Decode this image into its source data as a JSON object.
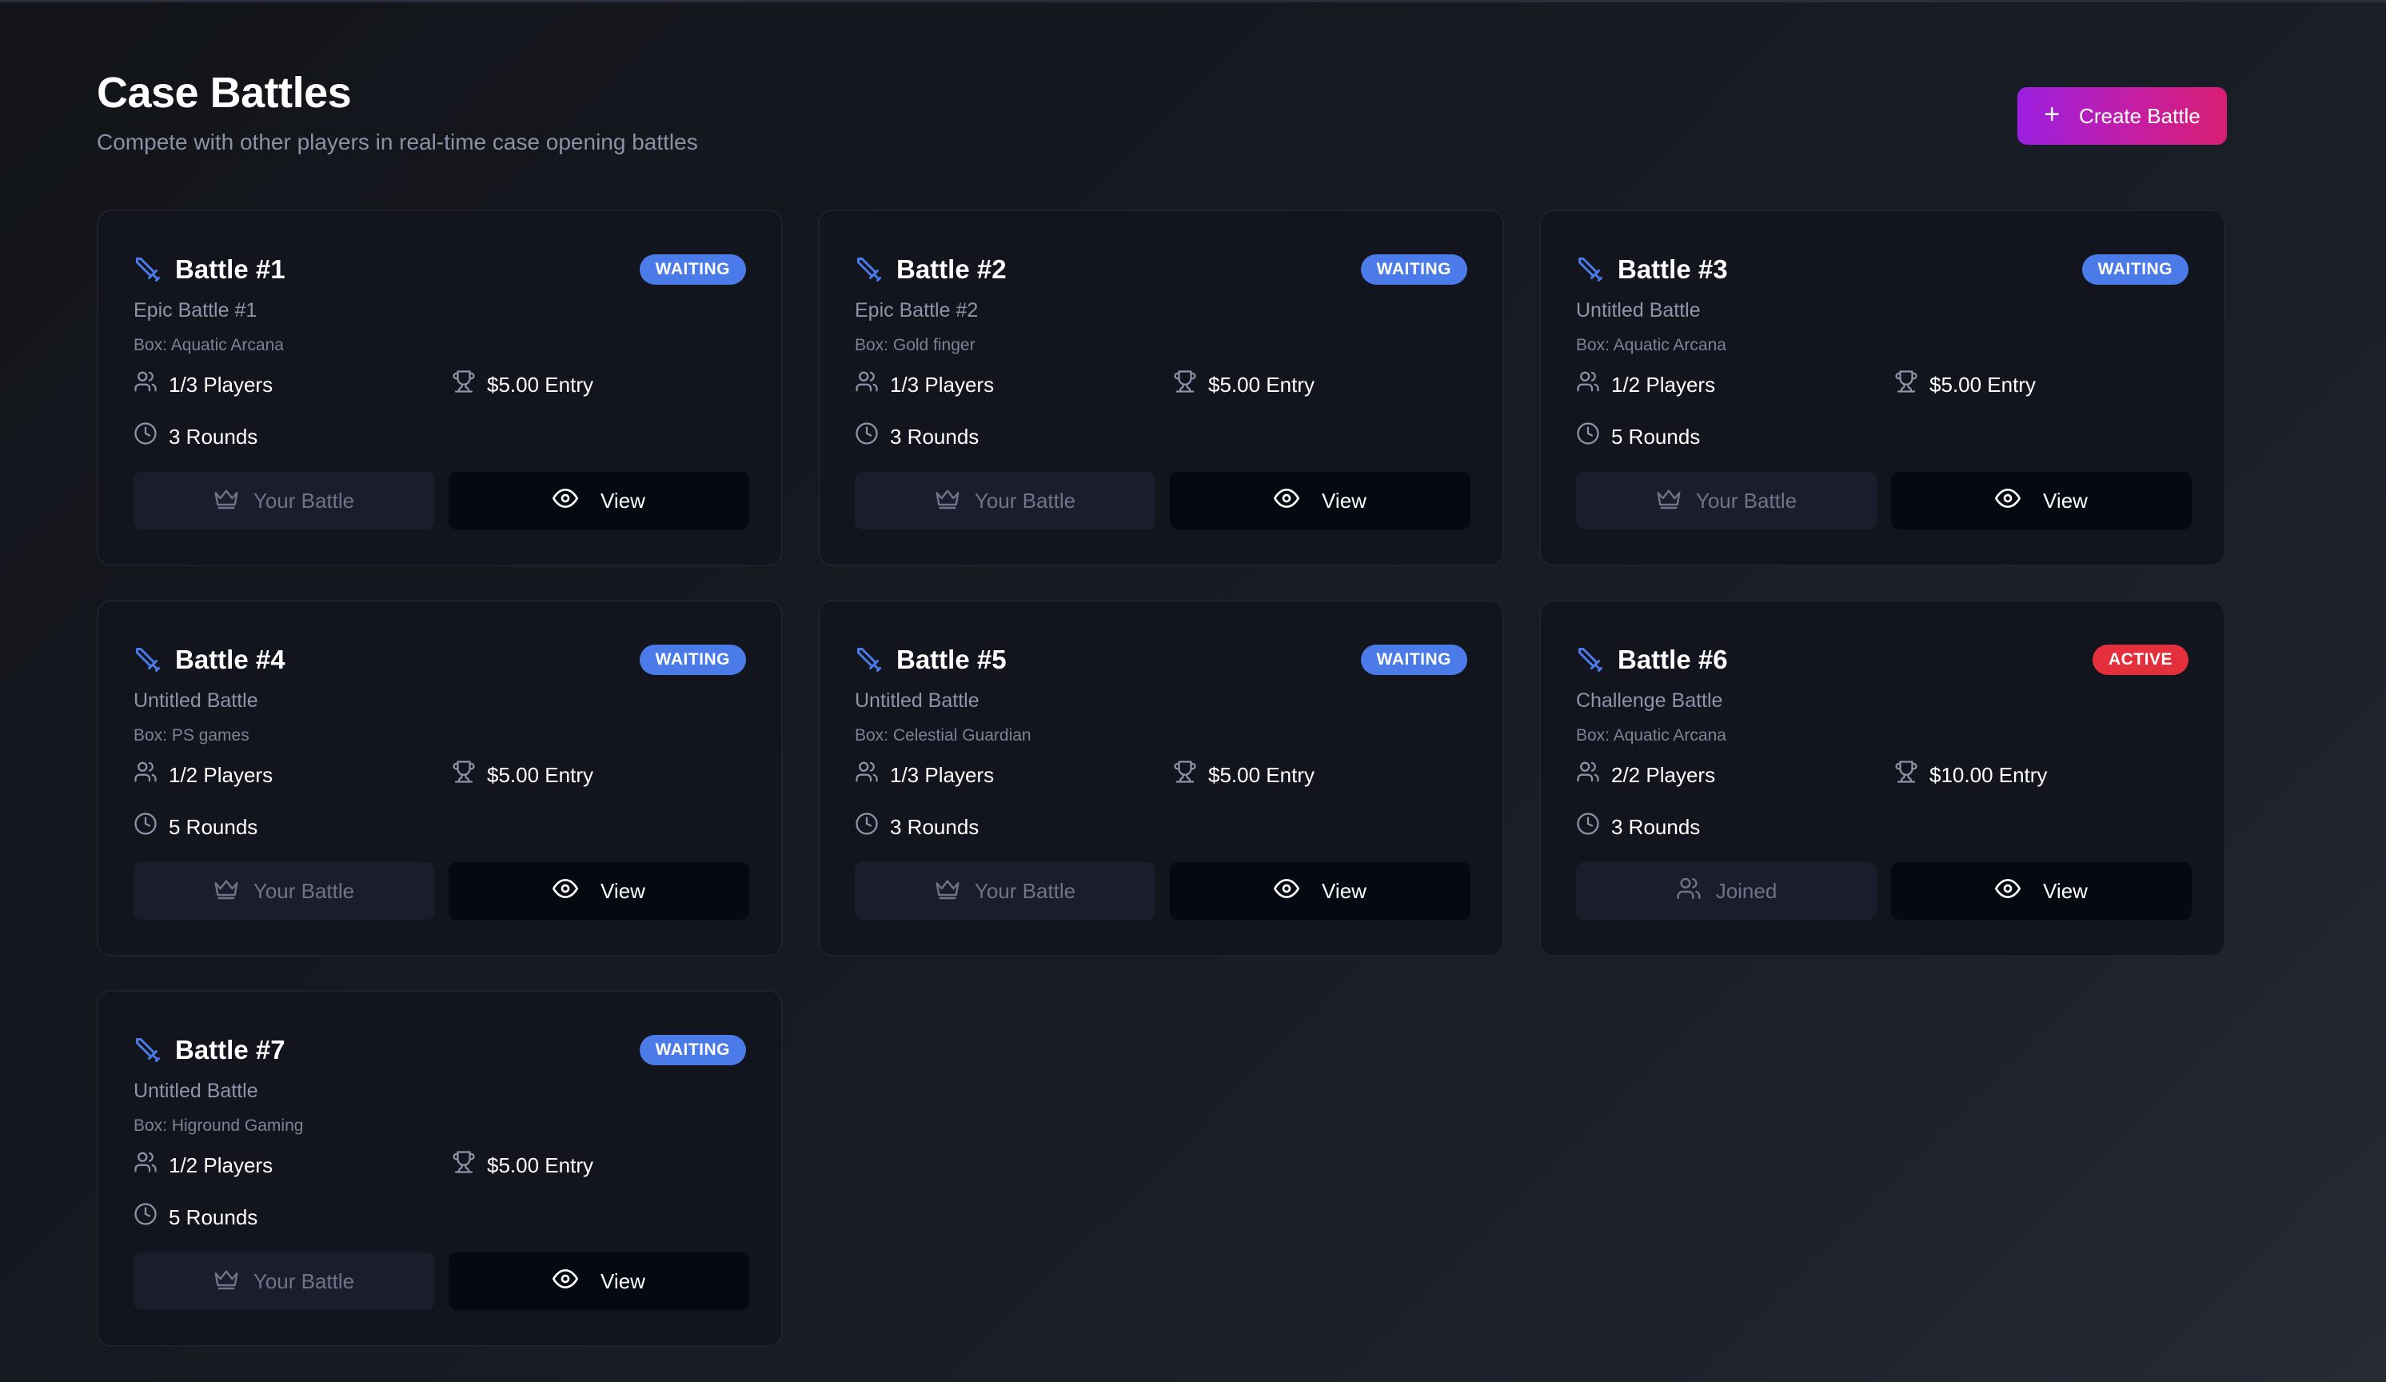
{
  "page": {
    "title": "Case Battles",
    "subtitle": "Compete with other players in real-time case opening battles"
  },
  "create_button": {
    "icon": "plus-icon",
    "label": "Create Battle"
  },
  "colors": {
    "waiting_badge": "#4b7be8",
    "active_badge": "#e42f3c",
    "sword_icon": "#4b7be8",
    "create_gradient_start": "#9b1fe0",
    "create_gradient_end": "#d81f72"
  },
  "battles": [
    {
      "name": "Battle #1",
      "status": "WAITING",
      "title": "Epic Battle #1",
      "box": "Box: Aquatic Arcana",
      "players": "1/3 Players",
      "entry": "$5.00 Entry",
      "rounds": "3 Rounds",
      "left_action": "Your Battle",
      "left_icon": "crown-icon",
      "view_label": "View"
    },
    {
      "name": "Battle #2",
      "status": "WAITING",
      "title": "Epic Battle #2",
      "box": "Box: Gold finger",
      "players": "1/3 Players",
      "entry": "$5.00 Entry",
      "rounds": "3 Rounds",
      "left_action": "Your Battle",
      "left_icon": "crown-icon",
      "view_label": "View"
    },
    {
      "name": "Battle #3",
      "status": "WAITING",
      "title": "Untitled Battle",
      "box": "Box: Aquatic Arcana",
      "players": "1/2 Players",
      "entry": "$5.00 Entry",
      "rounds": "5 Rounds",
      "left_action": "Your Battle",
      "left_icon": "crown-icon",
      "view_label": "View"
    },
    {
      "name": "Battle #4",
      "status": "WAITING",
      "title": "Untitled Battle",
      "box": "Box: PS games",
      "players": "1/2 Players",
      "entry": "$5.00 Entry",
      "rounds": "5 Rounds",
      "left_action": "Your Battle",
      "left_icon": "crown-icon",
      "view_label": "View"
    },
    {
      "name": "Battle #5",
      "status": "WAITING",
      "title": "Untitled Battle",
      "box": "Box: Celestial Guardian",
      "players": "1/3 Players",
      "entry": "$5.00 Entry",
      "rounds": "3 Rounds",
      "left_action": "Your Battle",
      "left_icon": "crown-icon",
      "view_label": "View"
    },
    {
      "name": "Battle #6",
      "status": "ACTIVE",
      "title": "Challenge Battle",
      "box": "Box: Aquatic Arcana",
      "players": "2/2 Players",
      "entry": "$10.00 Entry",
      "rounds": "3 Rounds",
      "left_action": "Joined",
      "left_icon": "users-icon",
      "view_label": "View"
    },
    {
      "name": "Battle #7",
      "status": "WAITING",
      "title": "Untitled Battle",
      "box": "Box: Higround Gaming",
      "players": "1/2 Players",
      "entry": "$5.00 Entry",
      "rounds": "5 Rounds",
      "left_action": "Your Battle",
      "left_icon": "crown-icon",
      "view_label": "View"
    }
  ]
}
